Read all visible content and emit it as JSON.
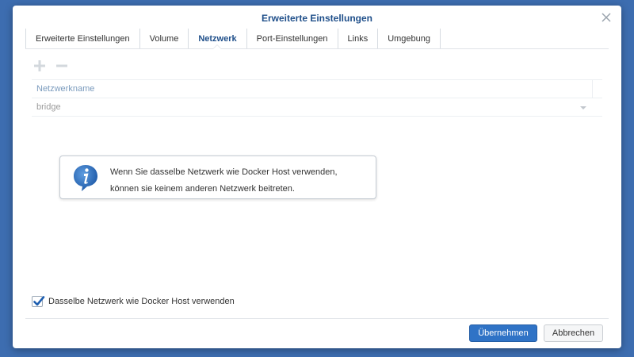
{
  "dialog": {
    "title": "Erweiterte Einstellungen"
  },
  "tabs": [
    {
      "label": "Erweiterte Einstellungen",
      "active": false
    },
    {
      "label": "Volume",
      "active": false
    },
    {
      "label": "Netzwerk",
      "active": true
    },
    {
      "label": "Port-Einstellungen",
      "active": false
    },
    {
      "label": "Links",
      "active": false
    },
    {
      "label": "Umgebung",
      "active": false
    }
  ],
  "toolbar": {
    "add_icon": "plus-icon",
    "remove_icon": "minus-icon"
  },
  "network_grid": {
    "column_header": "Netzwerkname",
    "rows": [
      {
        "name": "bridge"
      }
    ]
  },
  "info": {
    "icon": "info-icon",
    "line1": "Wenn Sie dasselbe Netzwerk wie Docker Host verwenden,",
    "line2": "können sie keinem anderen Netzwerk beitreten."
  },
  "option": {
    "label": "Dasselbe Netzwerk wie Docker Host verwenden",
    "checked": true
  },
  "buttons": {
    "apply": "Übernehmen",
    "cancel": "Abbrechen"
  },
  "colors": {
    "background": "#3d6db0",
    "accent": "#2f73c6",
    "title": "#1f4f8a"
  }
}
